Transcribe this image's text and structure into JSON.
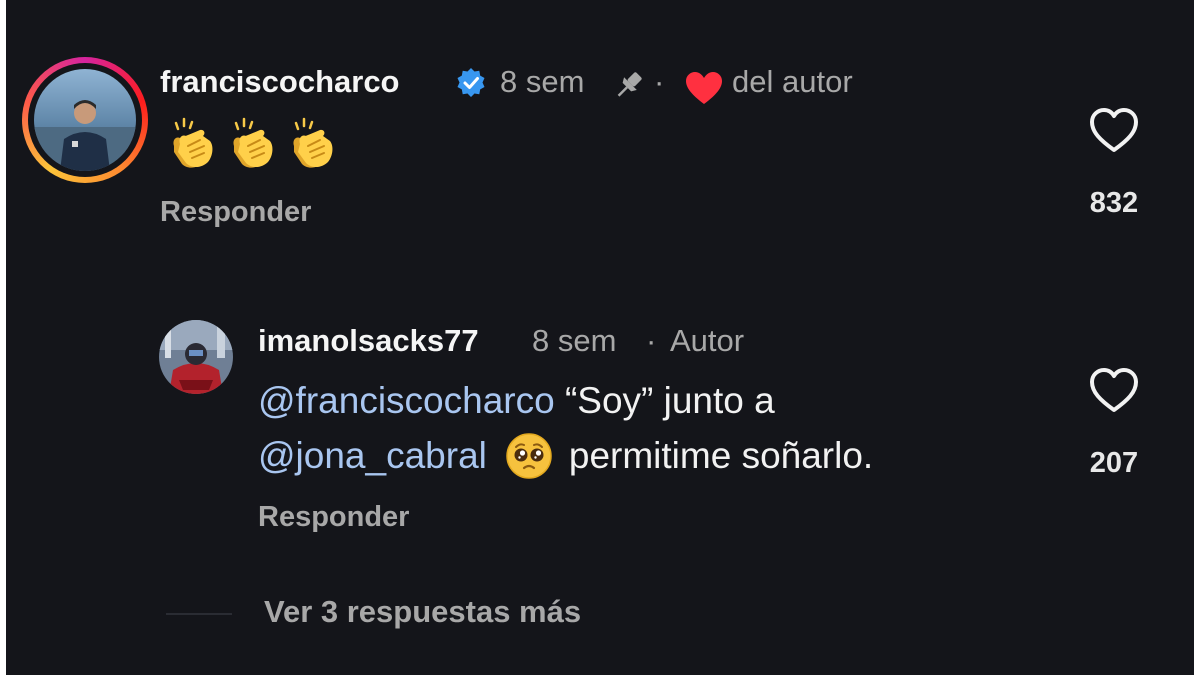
{
  "comment": {
    "username": "franciscocharco",
    "verified_icon": "verified-badge-icon",
    "time": "8 sem",
    "pin_icon": "pin-icon",
    "dot": "·",
    "author_heart_icon": "heart-filled-icon",
    "author_heart_color": "#ff3040",
    "liked_by_author": "del autor",
    "body_icons": [
      "clapping-hands-icon",
      "clapping-hands-icon",
      "clapping-hands-icon"
    ],
    "reply_label": "Responder",
    "like_icon": "heart-outline-icon",
    "like_count": "832"
  },
  "reply": {
    "username": "imanolsacks77",
    "time": "8 sem",
    "dot": "·",
    "author_label": "Autor",
    "mention_1": "@franciscocharco",
    "text_1": " “Soy” junto a",
    "mention_2": "@jona_cabral",
    "emoji_icon": "pleading-face-icon",
    "text_2": "permitime soñarlo.",
    "reply_label": "Responder",
    "like_icon": "heart-outline-icon",
    "like_count": "207"
  },
  "view_more": "Ver 3 respuestas más",
  "colors": {
    "background": "#14151a",
    "primary_text": "#f5f5f5",
    "secondary_text": "#a8a8a8",
    "mention": "#a9c6f0",
    "verified": "#3897f0"
  }
}
